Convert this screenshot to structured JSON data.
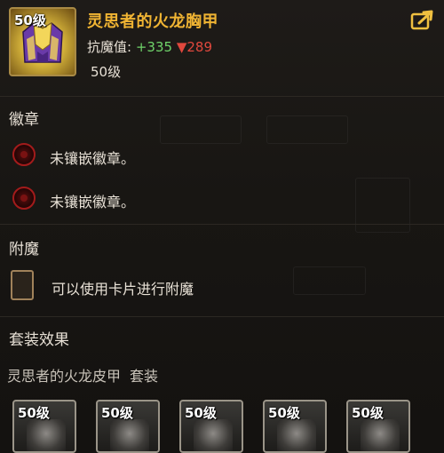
{
  "item": {
    "level_badge": "50级",
    "name": "灵思者的火龙胸甲",
    "stat_label": "抗魔值:",
    "stat_plus": "+335",
    "stat_minus": "▼289",
    "required_level": "50级",
    "icon": "purple-gold-chestplate"
  },
  "emblem": {
    "title": "徽章",
    "slots": [
      "未镶嵌徽章。",
      "未镶嵌徽章。"
    ]
  },
  "enchant": {
    "title": "附魔",
    "hint": "可以使用卡片进行附魔"
  },
  "set": {
    "title": "套装效果",
    "name": "灵思者的火龙皮甲",
    "tag": "套装",
    "pieces": [
      "50级",
      "50级",
      "50级",
      "50级",
      "50级"
    ]
  },
  "colors": {
    "name": "#f0b433",
    "plus": "#6fd36a",
    "minus": "#e0483d",
    "socket": "#a31b1b"
  },
  "icons": [
    "share-icon",
    "socket-icon",
    "card-slot-icon"
  ]
}
